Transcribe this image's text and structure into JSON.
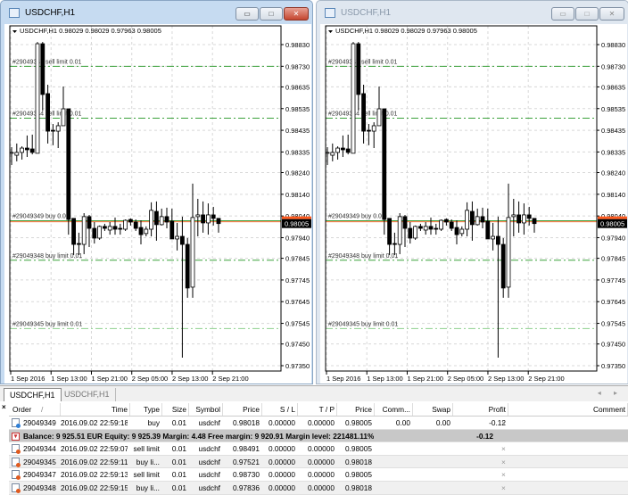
{
  "windows": [
    {
      "title": "USDCHF,H1",
      "state": "active"
    },
    {
      "title": "USDCHF,H1",
      "state": "inactive"
    }
  ],
  "title_buttons": {
    "minimize": "▭",
    "maximize": "□",
    "close": "✕"
  },
  "chart": {
    "header": "USDCHF,H1  0.98029 0.98029 0.97963 0.98005",
    "symbol": "USDCHF",
    "timeframe": "H1",
    "current_price": "0.98005",
    "price_ticks": [
      "0.98830",
      "0.98730",
      "0.98635",
      "0.98535",
      "0.98435",
      "0.98335",
      "0.98240",
      "0.98140",
      "0.98040",
      "0.97940",
      "0.97845",
      "0.97745",
      "0.97645",
      "0.97545",
      "0.97450",
      "0.97350"
    ],
    "time_ticks": [
      "1 Sep 2016",
      "1 Sep 13:00",
      "1 Sep 21:00",
      "2 Sep 05:00",
      "2 Sep 13:00",
      "2 Sep 21:00"
    ],
    "ylim": [
      0.9735,
      0.9883
    ],
    "colors": {
      "bull_body": "#ffffff",
      "bear_body": "#000000",
      "order_line": "#3aa13a",
      "pending_buy_far": "#8fd08f",
      "bid_line": "#ff5a1e",
      "grid": "#d8d8d8"
    },
    "order_lines": [
      {
        "label": "#29049347 sell limit 0.01",
        "price": 0.9873,
        "style": "dashdot"
      },
      {
        "label": "#29049344 sell limit 0.01",
        "price": 0.98491,
        "style": "dashdot"
      },
      {
        "label": "#29049349 buy 0.01",
        "price": 0.98018,
        "style": "solid"
      },
      {
        "label": "#29049348 buy limit 0.01",
        "price": 0.97836,
        "style": "dashdot"
      },
      {
        "label": "#29049345 buy limit 0.01",
        "price": 0.97521,
        "style": "dashdot-light"
      }
    ],
    "ohlc": [
      [
        0.98333,
        0.98357,
        0.98275,
        0.98333
      ],
      [
        0.9832,
        0.98374,
        0.98292,
        0.98333
      ],
      [
        0.98333,
        0.98361,
        0.983,
        0.98353
      ],
      [
        0.98353,
        0.98411,
        0.98312,
        0.98345
      ],
      [
        0.98349,
        0.98415,
        0.98324,
        0.98333
      ],
      [
        0.98329,
        0.98842,
        0.98329,
        0.98834
      ],
      [
        0.98834,
        0.98842,
        0.98526,
        0.986
      ],
      [
        0.98604,
        0.98645,
        0.98374,
        0.98431
      ],
      [
        0.98435,
        0.98464,
        0.98366,
        0.98431
      ],
      [
        0.98431,
        0.98472,
        0.98353,
        0.98456
      ],
      [
        0.98456,
        0.98637,
        0.98456,
        0.98534
      ],
      [
        0.98534,
        0.98534,
        0.97954,
        0.98024
      ],
      [
        0.98029,
        0.98029,
        0.9786,
        0.97909
      ],
      [
        0.97913,
        0.97963,
        0.9786,
        0.97909
      ],
      [
        0.97909,
        0.98053,
        0.97864,
        0.98037
      ],
      [
        0.98037,
        0.98045,
        0.97897,
        0.97983
      ],
      [
        0.97983,
        0.98012,
        0.97913,
        0.97938
      ],
      [
        0.97938,
        0.97996,
        0.9793,
        0.97992
      ],
      [
        0.97992,
        0.98004,
        0.97971,
        0.97983
      ],
      [
        0.97975,
        0.98012,
        0.97954,
        0.97992
      ],
      [
        0.97992,
        0.98033,
        0.97954,
        0.97979
      ],
      [
        0.97983,
        0.98004,
        0.97954,
        0.97979
      ],
      [
        0.97979,
        0.98024,
        0.97971,
        0.9802
      ],
      [
        0.98024,
        0.98029,
        0.97996,
        0.98012
      ],
      [
        0.98012,
        0.98024,
        0.97971,
        0.97983
      ],
      [
        0.97987,
        0.9802,
        0.97909,
        0.97954
      ],
      [
        0.97959,
        0.97992,
        0.97946,
        0.97979
      ],
      [
        0.97979,
        0.98103,
        0.97946,
        0.98066
      ],
      [
        0.98061,
        0.98107,
        0.97926,
        0.98
      ],
      [
        0.98,
        0.98074,
        0.97996,
        0.98037
      ],
      [
        0.98037,
        0.98078,
        0.97983,
        0.98012
      ],
      [
        0.98016,
        0.98074,
        0.97934,
        0.97934
      ],
      [
        0.97934,
        0.98008,
        0.97881,
        0.97946
      ],
      [
        0.97946,
        0.98037,
        0.97387,
        0.97909
      ],
      [
        0.97909,
        0.97938,
        0.97663,
        0.97708
      ],
      [
        0.97712,
        0.98189,
        0.97663,
        0.98033
      ],
      [
        0.98037,
        0.98119,
        0.97946,
        0.98045
      ],
      [
        0.98045,
        0.98107,
        0.97963,
        0.98008
      ],
      [
        0.98008,
        0.98098,
        0.97954,
        0.98045
      ],
      [
        0.98045,
        0.98082,
        0.97996,
        0.98029
      ],
      [
        0.98029,
        0.98029,
        0.97963,
        0.98005
      ]
    ]
  },
  "tabs": [
    {
      "label": "USDCHF,H1",
      "selected": true
    },
    {
      "label": "USDCHF,H1",
      "selected": false
    }
  ],
  "tab_arrows": "◂ ▸",
  "terminal_close": "×",
  "table": {
    "columns": [
      "Order",
      "/",
      "Time",
      "Type",
      "Size",
      "Symbol",
      "Price",
      "S / L",
      "T / P",
      "Price",
      "Comm...",
      "Swap",
      "Profit",
      "Comment"
    ],
    "rows": [
      {
        "order": "29049349",
        "time": "2016.09.02 22:59:18",
        "type": "buy",
        "size": "0.01",
        "symbol": "usdchf",
        "price": "0.98018",
        "sl": "0.00000",
        "tp": "0.00000",
        "cur": "0.98005",
        "comm": "0.00",
        "swap": "0.00",
        "profit": "-0.12",
        "kind": "open"
      },
      {
        "order": "29049344",
        "time": "2016.09.02 22:59:07",
        "type": "sell limit",
        "size": "0.01",
        "symbol": "usdchf",
        "price": "0.98491",
        "sl": "0.00000",
        "tp": "0.00000",
        "cur": "0.98005",
        "comm": "",
        "swap": "",
        "profit": "",
        "kind": "pending"
      },
      {
        "order": "29049345",
        "time": "2016.09.02 22:59:11",
        "type": "buy li...",
        "size": "0.01",
        "symbol": "usdchf",
        "price": "0.97521",
        "sl": "0.00000",
        "tp": "0.00000",
        "cur": "0.98018",
        "comm": "",
        "swap": "",
        "profit": "",
        "kind": "pending"
      },
      {
        "order": "29049347",
        "time": "2016.09.02 22:59:13",
        "type": "sell limit",
        "size": "0.01",
        "symbol": "usdchf",
        "price": "0.98730",
        "sl": "0.00000",
        "tp": "0.00000",
        "cur": "0.98005",
        "comm": "",
        "swap": "",
        "profit": "",
        "kind": "pending"
      },
      {
        "order": "29049348",
        "time": "2016.09.02 22:59:15",
        "type": "buy li...",
        "size": "0.01",
        "symbol": "usdchf",
        "price": "0.97836",
        "sl": "0.00000",
        "tp": "0.00000",
        "cur": "0.98018",
        "comm": "",
        "swap": "",
        "profit": "",
        "kind": "pending"
      }
    ],
    "balance_line": "Balance: 9 925.51 EUR  Equity: 9 925.39  Margin: 4.48  Free margin: 9 920.91  Margin level: 221481.11%",
    "balance_profit": "-0.12",
    "delete_mark": "×"
  }
}
